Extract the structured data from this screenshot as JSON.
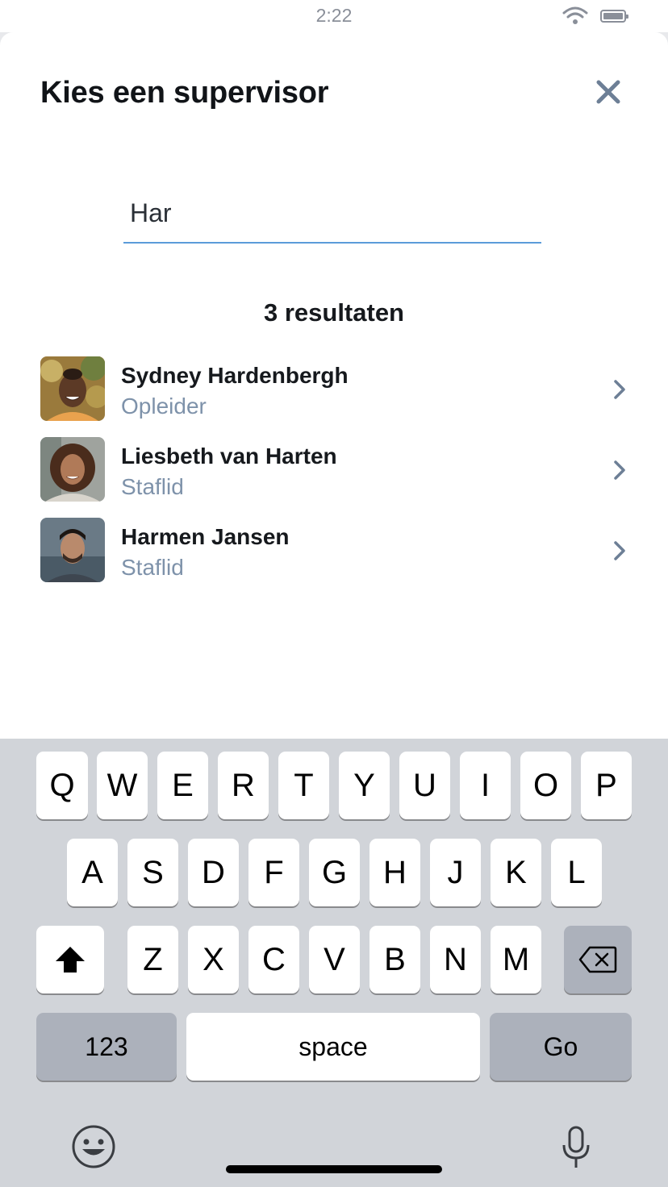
{
  "status_bar": {
    "time": "2:22",
    "wifi_icon": "wifi-icon",
    "battery_icon": "battery-icon"
  },
  "header": {
    "title": "Kies een supervisor",
    "close_icon": "close-icon"
  },
  "search": {
    "value": "Har",
    "placeholder": ""
  },
  "results": {
    "count_label": "3 resultaten",
    "items": [
      {
        "name": "Sydney Hardenbergh",
        "role": "Opleider",
        "avatar": "avatar-photo"
      },
      {
        "name": "Liesbeth van Harten",
        "role": "Staflid",
        "avatar": "avatar-photo"
      },
      {
        "name": "Harmen Jansen",
        "role": "Staflid",
        "avatar": "avatar-photo"
      }
    ]
  },
  "keyboard": {
    "row1": [
      "Q",
      "W",
      "E",
      "R",
      "T",
      "Y",
      "U",
      "I",
      "O",
      "P"
    ],
    "row2": [
      "A",
      "S",
      "D",
      "F",
      "G",
      "H",
      "J",
      "K",
      "L"
    ],
    "row3": [
      "Z",
      "X",
      "C",
      "V",
      "B",
      "N",
      "M"
    ],
    "numbers_label": "123",
    "space_label": "space",
    "go_label": "Go",
    "shift_icon": "shift-icon",
    "backspace_icon": "backspace-icon",
    "emoji_icon": "emoji-icon",
    "mic_icon": "microphone-icon"
  },
  "colors": {
    "accent": "#5b9bd9",
    "secondary_text": "#7e92aa",
    "close_icon": "#6d7f96",
    "keyboard_bg": "#d1d4d9",
    "key_dark": "#acb1bb"
  }
}
